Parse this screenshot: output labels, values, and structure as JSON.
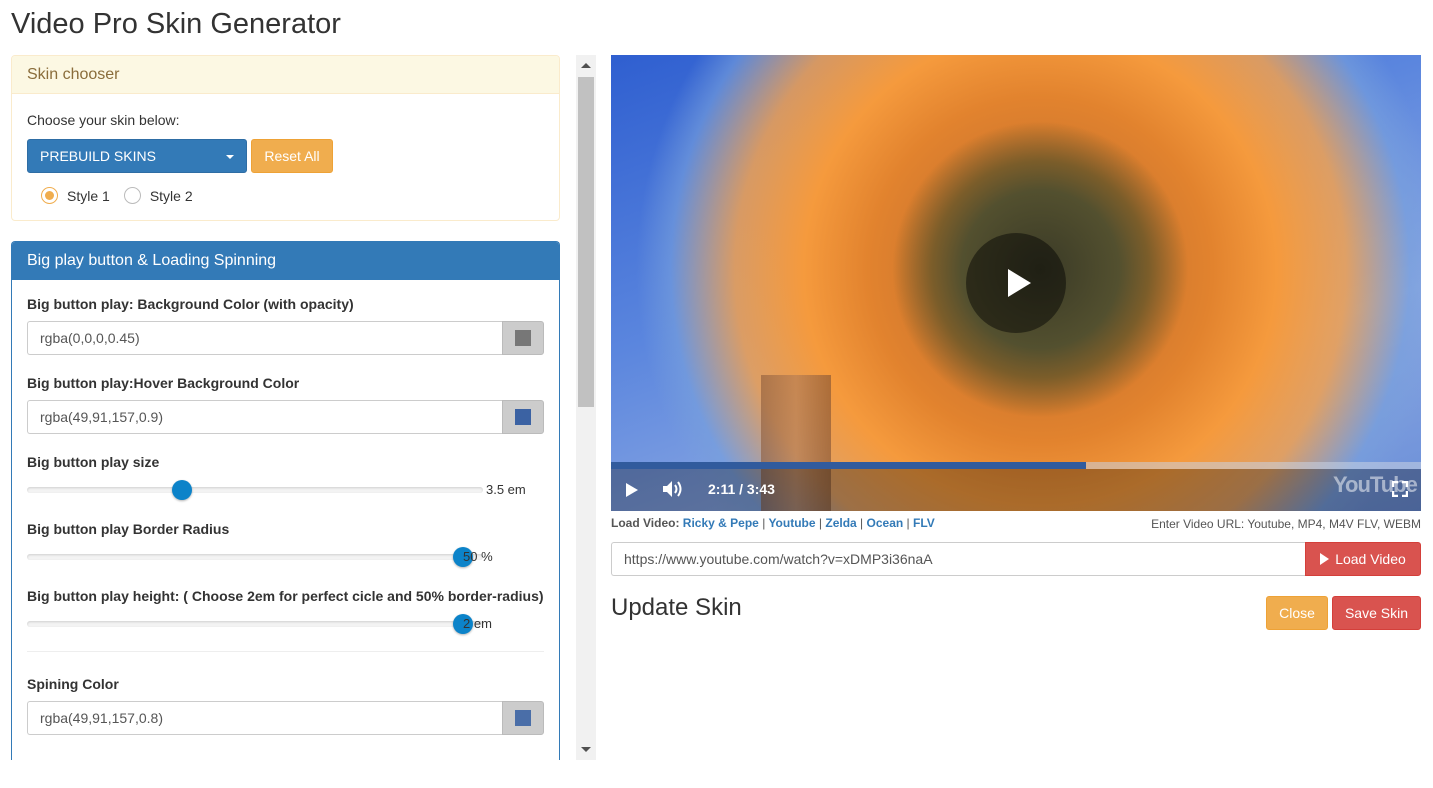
{
  "page": {
    "title": "Video Pro Skin Generator"
  },
  "skin_chooser": {
    "heading": "Skin chooser",
    "choose_label": "Choose your skin below:",
    "dropdown_label": "PREBUILD SKINS",
    "reset_label": "Reset All",
    "styles": [
      {
        "label": "Style 1",
        "checked": true
      },
      {
        "label": "Style 2",
        "checked": false
      }
    ]
  },
  "big_play_panel": {
    "heading": "Big play button & Loading Spinning",
    "bg_color": {
      "label": "Big button play: Background Color (with opacity)",
      "value": "rgba(0,0,0,0.45)",
      "swatch": "#777777"
    },
    "hover_color": {
      "label": "Big button play:Hover Background Color",
      "value": "rgba(49,91,157,0.9)",
      "swatch": "#3b62a3"
    },
    "size": {
      "label": "Big button play size",
      "value_text": "3.5 em",
      "fraction": 0.355
    },
    "border_radius": {
      "label": "Big button play Border Radius",
      "value_text": "50 %",
      "fraction": 1.0
    },
    "height": {
      "label": "Big button play height: ( Choose 2em for perfect cicle and 50% border-radius)",
      "value_text": "2 em",
      "fraction": 1.0
    },
    "spinning_color": {
      "label": "Spining Color",
      "value": "rgba(49,91,157,0.8)",
      "swatch": "#4a6ea8"
    }
  },
  "player": {
    "time_current": "2:11",
    "time_sep": "/",
    "time_total": "3:43",
    "progress_fraction": 0.586,
    "youtube_logo": "YouTube",
    "icons": [
      "play-icon",
      "volume-icon",
      "fullscreen-icon",
      "big-play-icon"
    ]
  },
  "load_video": {
    "label": "Load Video:",
    "links": [
      "Ricky & Pepe",
      "Youtube",
      "Zelda",
      "Ocean",
      "FLV"
    ],
    "hint": "Enter Video URL: Youtube, MP4, M4V FLV, WEBM",
    "url": "https://www.youtube.com/watch?v=xDMP3i36naA",
    "button_label": "Load Video"
  },
  "update_skin": {
    "title": "Update Skin",
    "close_label": "Close",
    "save_label": "Save Skin"
  }
}
